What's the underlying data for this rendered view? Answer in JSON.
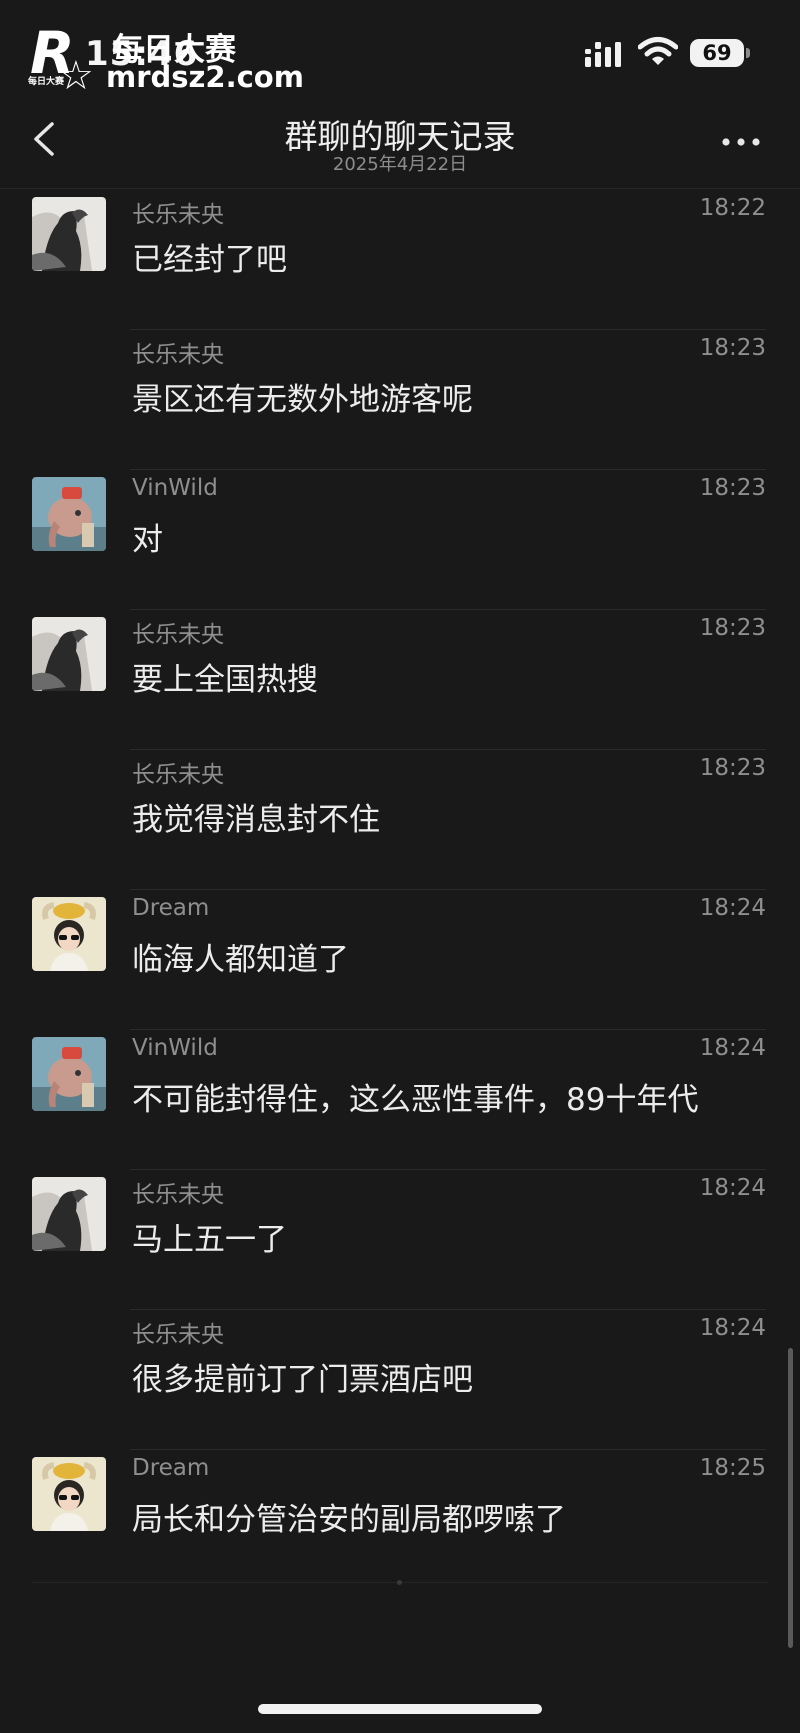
{
  "status_bar": {
    "time": "15:46",
    "battery": "69"
  },
  "watermark": {
    "brand": "每日大赛",
    "url": "mrdsz2.com",
    "small": "每日大赛"
  },
  "header": {
    "title": "群聊的聊天记录",
    "date": "2025年4月22日"
  },
  "icons": {
    "back": "chevron-left-icon",
    "more": "more-dots-icon",
    "signal": "signal-icon",
    "wifi": "wifi-icon"
  },
  "messages": [
    {
      "sender": "长乐未央",
      "time": "18:22",
      "text": "已经封了吧",
      "avatar": "ink-figure"
    },
    {
      "sender": "长乐未央",
      "time": "18:23",
      "text": "景区还有无数外地游客呢",
      "avatar": ""
    },
    {
      "sender": "VinWild",
      "time": "18:23",
      "text": "对",
      "avatar": "elephant-art"
    },
    {
      "sender": "长乐未央",
      "time": "18:23",
      "text": "要上全国热搜",
      "avatar": "ink-figure"
    },
    {
      "sender": "长乐未央",
      "time": "18:23",
      "text": "我觉得消息封不住",
      "avatar": ""
    },
    {
      "sender": "Dream",
      "time": "18:24",
      "text": "临海人都知道了",
      "avatar": "girl-bowl"
    },
    {
      "sender": "VinWild",
      "time": "18:24",
      "text": "不可能封得住，这么恶性事件，89十年代",
      "avatar": "elephant-art"
    },
    {
      "sender": "长乐未央",
      "time": "18:24",
      "text": "马上五一了",
      "avatar": "ink-figure"
    },
    {
      "sender": "长乐未央",
      "time": "18:24",
      "text": "很多提前订了门票酒店吧",
      "avatar": ""
    },
    {
      "sender": "Dream",
      "time": "18:25",
      "text": "局长和分管治安的副局都啰嗦了",
      "avatar": "girl-bowl"
    }
  ]
}
